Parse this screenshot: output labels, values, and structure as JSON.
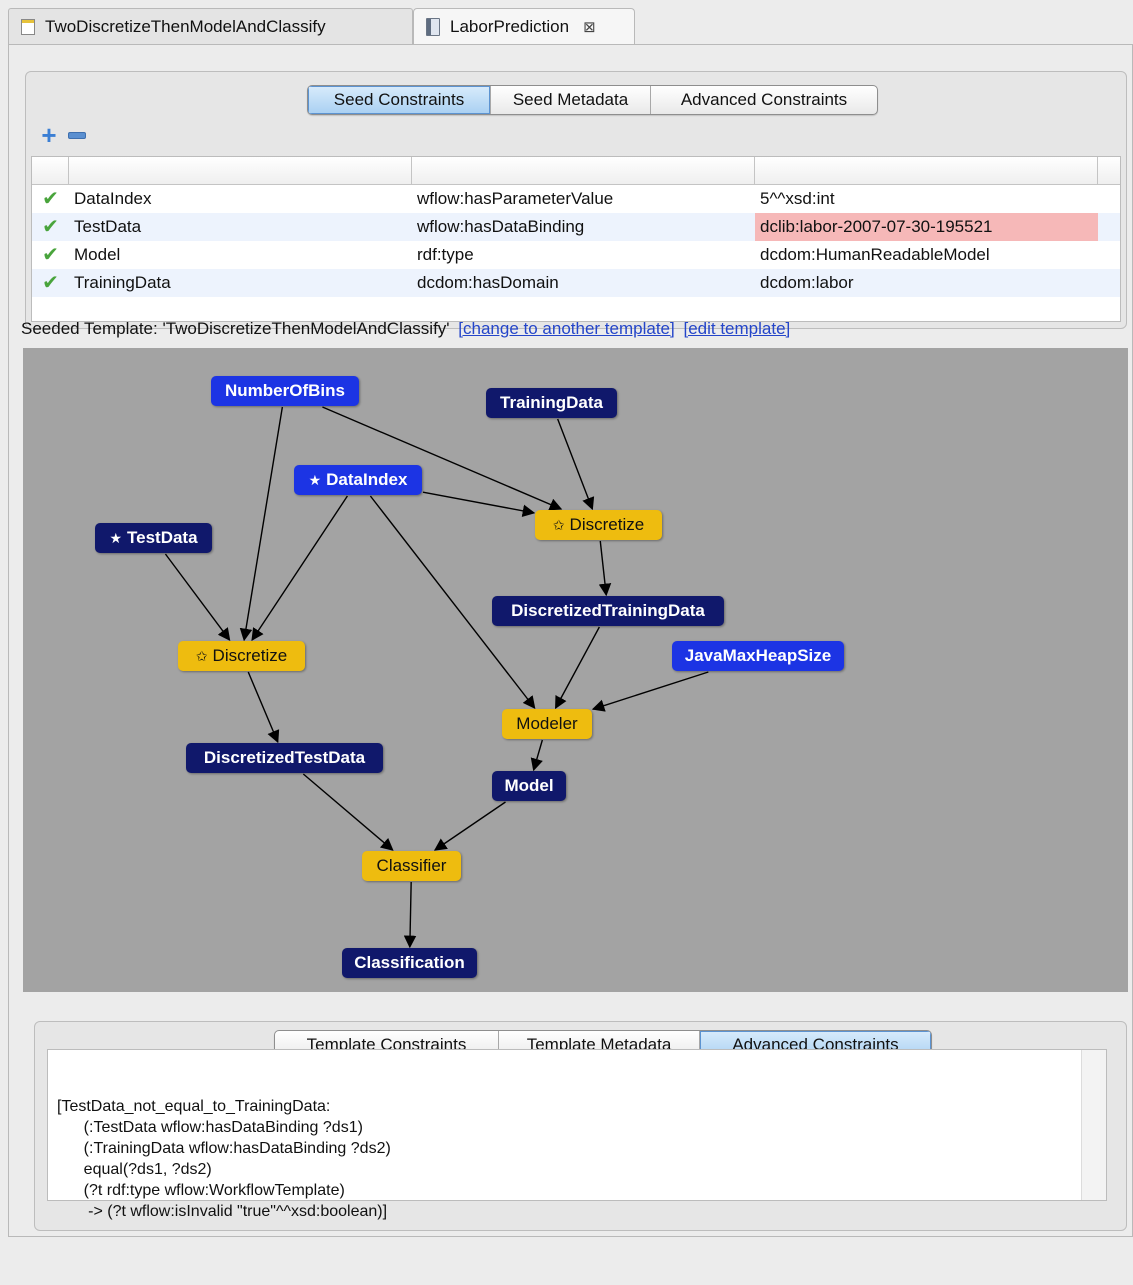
{
  "editor_tabs": [
    {
      "label": "TwoDiscretizeThenModelAndClassify",
      "icon": "file-icon",
      "active": false
    },
    {
      "label": "LaborPrediction",
      "icon": "book-icon",
      "active": true,
      "close": "⊠"
    }
  ],
  "seed_tabs": [
    "Seed Constraints",
    "Seed Metadata",
    "Advanced Constraints"
  ],
  "seed_tab_selected": "Seed Constraints",
  "toolbar": {
    "add": "+",
    "remove": "−"
  },
  "constraints": [
    {
      "subject": "DataIndex",
      "predicate": "wflow:hasParameterValue",
      "object": "5^^xsd:int",
      "error": false
    },
    {
      "subject": "TestData",
      "predicate": "wflow:hasDataBinding",
      "object": "dclib:labor-2007-07-30-195521",
      "error": true
    },
    {
      "subject": "Model",
      "predicate": "rdf:type",
      "object": "dcdom:HumanReadableModel",
      "error": false
    },
    {
      "subject": "TrainingData",
      "predicate": "dcdom:hasDomain",
      "object": "dcdom:labor",
      "error": false
    }
  ],
  "seeded": {
    "prefix": "Seeded Template: 'TwoDiscretizeThenModelAndClassify'",
    "change_link": "[change to another template]",
    "edit_link": "[edit template]"
  },
  "graph": {
    "colors": {
      "data": "#10186b",
      "param": "#1c34e4",
      "component": "#eebc0f",
      "edge": "#000000",
      "background": "#a3a3a3"
    },
    "nodes": {
      "numberofbins": {
        "label": "NumberOfBins",
        "kind": "param",
        "starred": false
      },
      "trainingdata": {
        "label": "TrainingData",
        "kind": "data",
        "starred": false
      },
      "dataindex": {
        "label": "DataIndex",
        "kind": "param",
        "starred": true
      },
      "testdata": {
        "label": "TestData",
        "kind": "data",
        "starred": true
      },
      "discretize1": {
        "label": "Discretize",
        "kind": "component",
        "starred": true
      },
      "discretizedtrainingdata": {
        "label": "DiscretizedTrainingData",
        "kind": "data",
        "starred": false
      },
      "javamaxheapsize": {
        "label": "JavaMaxHeapSize",
        "kind": "param",
        "starred": false
      },
      "discretize2": {
        "label": "Discretize",
        "kind": "component",
        "starred": true
      },
      "modeler": {
        "label": "Modeler",
        "kind": "component",
        "starred": false
      },
      "discretizedtestdata": {
        "label": "DiscretizedTestData",
        "kind": "data",
        "starred": false
      },
      "model": {
        "label": "Model",
        "kind": "data",
        "starred": false
      },
      "classifier": {
        "label": "Classifier",
        "kind": "component",
        "starred": false
      },
      "classification": {
        "label": "Classification",
        "kind": "data",
        "starred": false
      }
    },
    "edges": [
      [
        "numberofbins",
        "discretize1"
      ],
      [
        "numberofbins",
        "discretize2"
      ],
      [
        "trainingdata",
        "discretize1"
      ],
      [
        "dataindex",
        "discretize1"
      ],
      [
        "dataindex",
        "discretize2"
      ],
      [
        "dataindex",
        "modeler"
      ],
      [
        "testdata",
        "discretize2"
      ],
      [
        "discretize1",
        "discretizedtrainingdata"
      ],
      [
        "discretizedtrainingdata",
        "modeler"
      ],
      [
        "javamaxheapsize",
        "modeler"
      ],
      [
        "discretize2",
        "discretizedtestdata"
      ],
      [
        "modeler",
        "model"
      ],
      [
        "discretizedtestdata",
        "classifier"
      ],
      [
        "model",
        "classifier"
      ],
      [
        "classifier",
        "classification"
      ]
    ]
  },
  "template_tabs": [
    "Template Constraints",
    "Template Metadata",
    "Advanced Constraints"
  ],
  "template_tab_selected": "Advanced Constraints",
  "rules_text": "[TestData_not_equal_to_TrainingData:\n      (:TestData wflow:hasDataBinding ?ds1)\n      (:TrainingData wflow:hasDataBinding ?ds2)\n      equal(?ds1, ?ds2)\n      (?t rdf:type wflow:WorkflowTemplate)\n       -> (?t wflow:isInvalid \"true\"^^xsd:boolean)]"
}
